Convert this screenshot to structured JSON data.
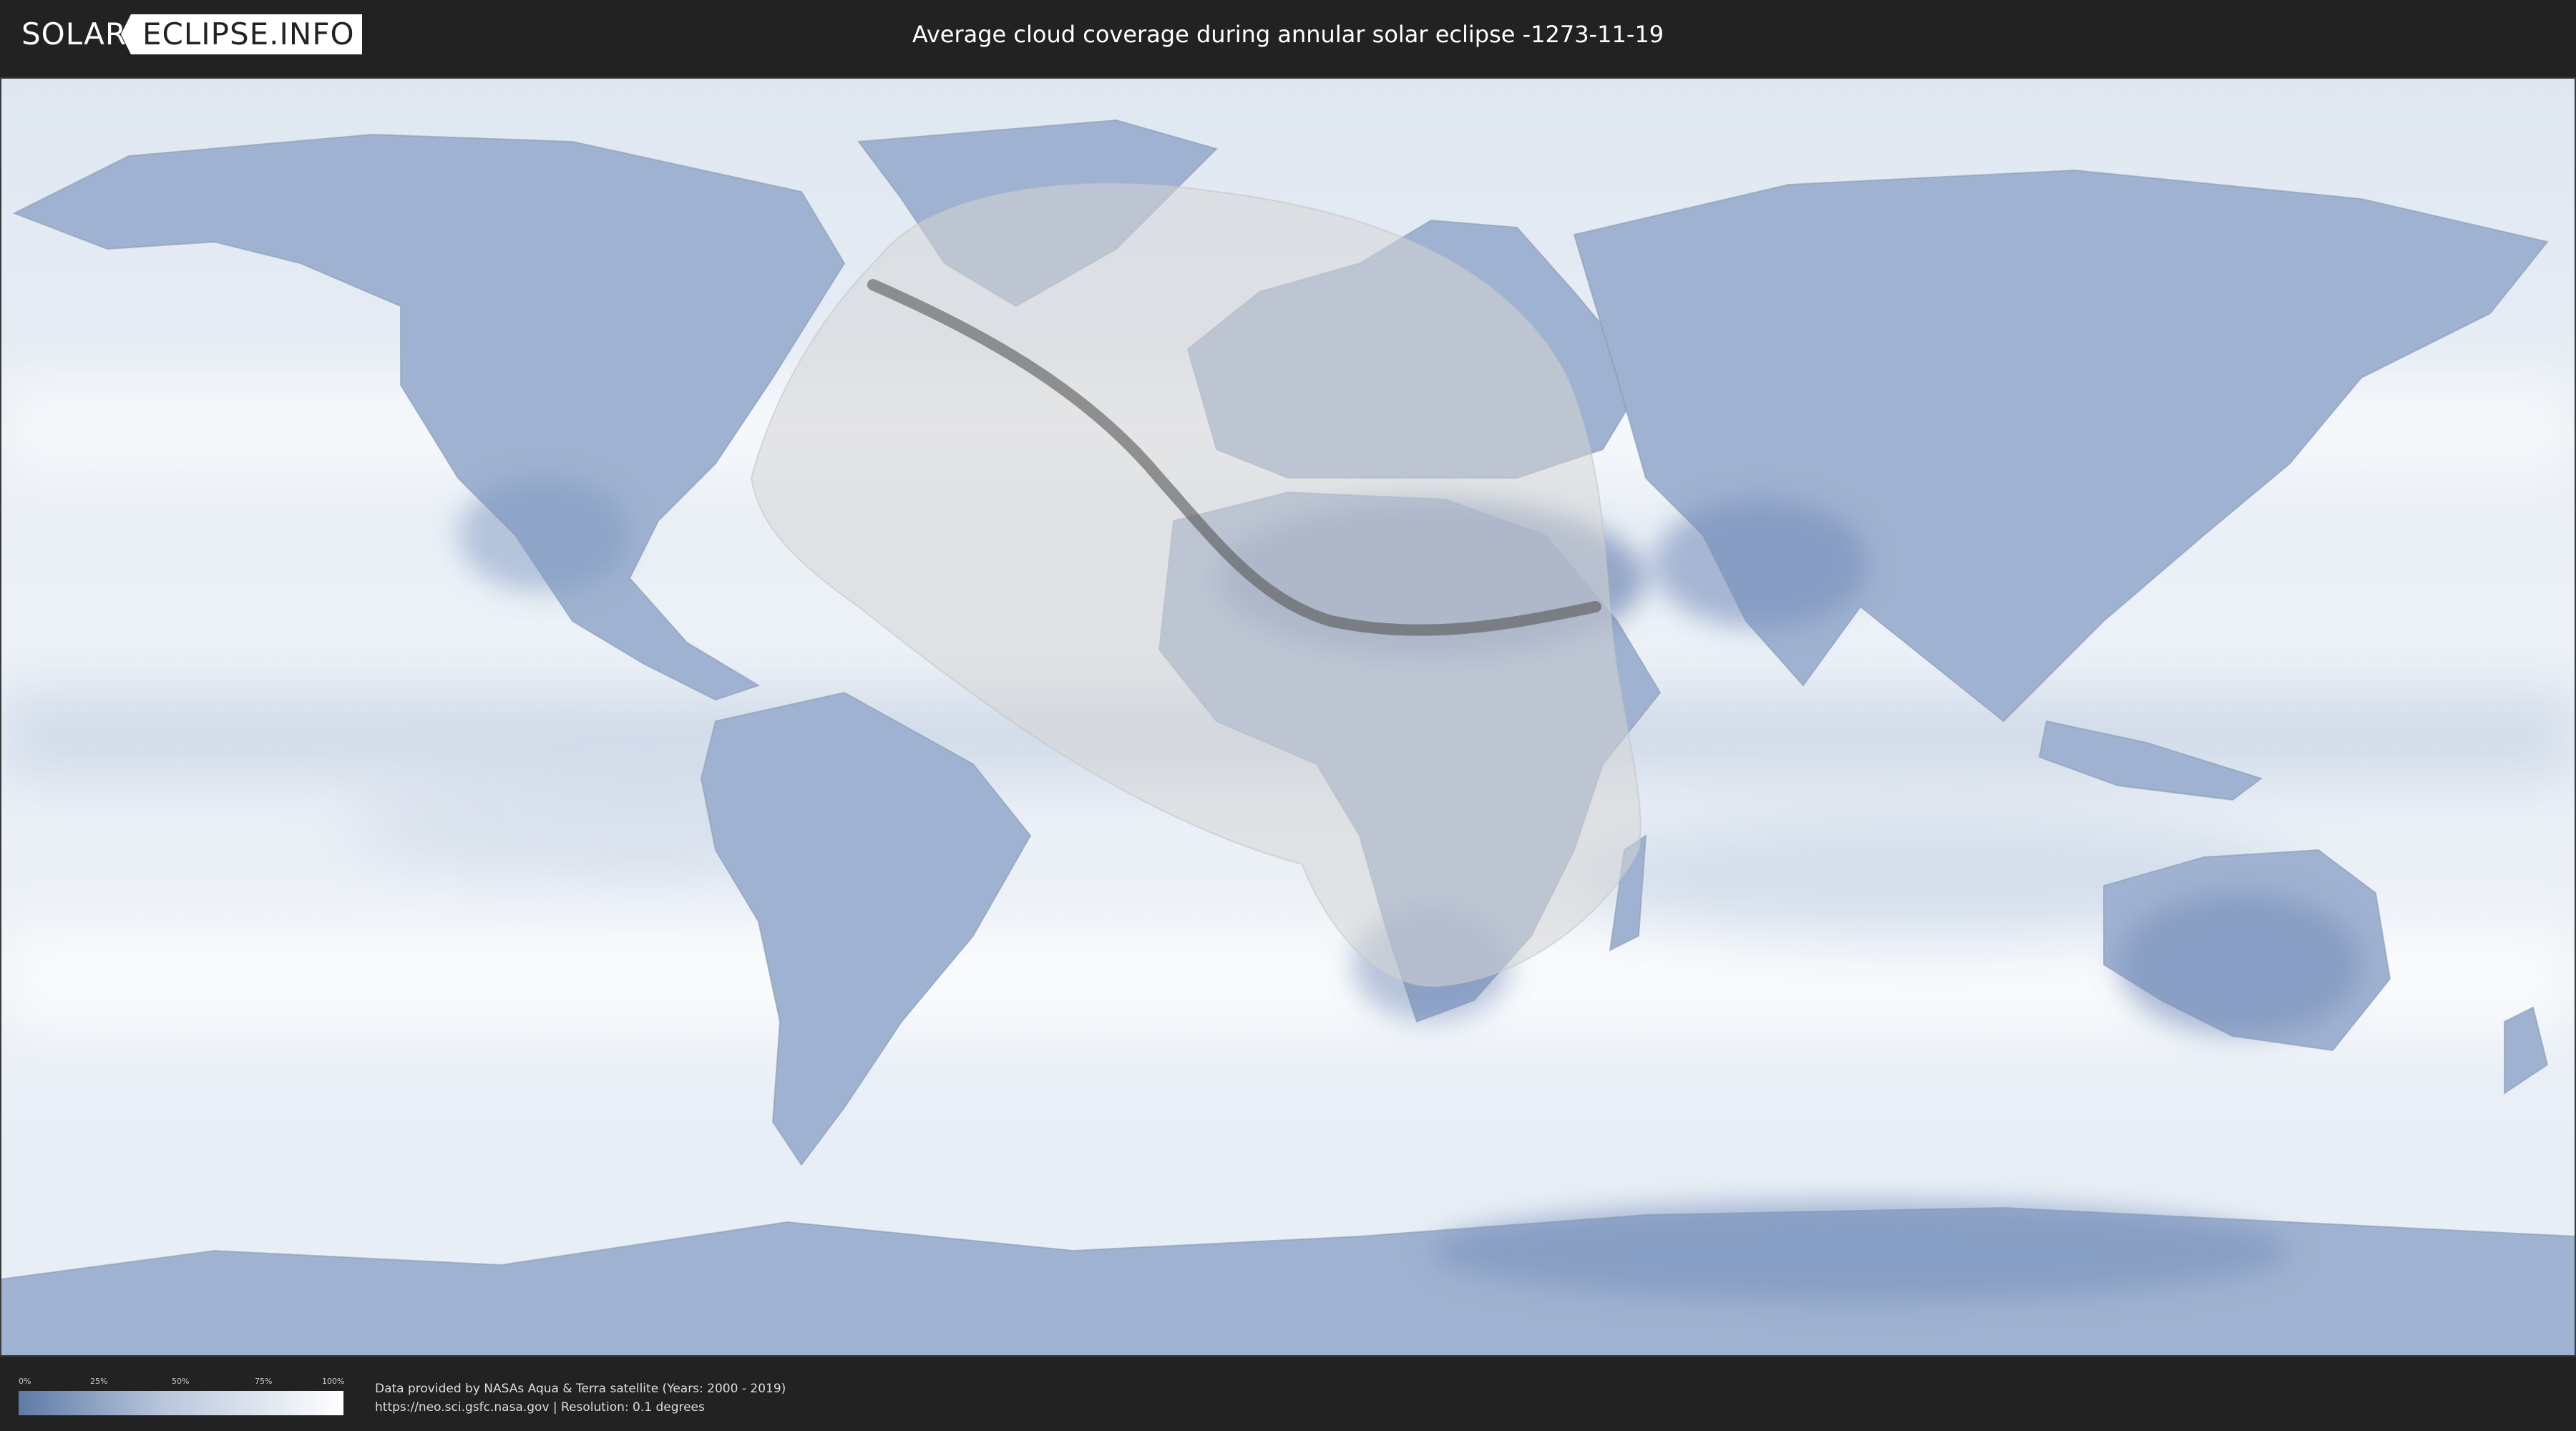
{
  "header": {
    "logo_left": "SOLAR",
    "logo_right": "ECLIPSE.INFO",
    "title": "Average cloud coverage during annular solar eclipse -1273-11-19"
  },
  "legend": {
    "ticks": [
      "0%",
      "25%",
      "50%",
      "75%",
      "100%"
    ],
    "scale_values": [
      0,
      25,
      50,
      75,
      100
    ],
    "colors": {
      "low": "#5f7aa7",
      "mid": "#b9c7dc",
      "high": "#ffffff"
    }
  },
  "credits": {
    "line1": "Data provided by NASAs Aqua & Terra satellite (Years: 2000 - 2019)",
    "line2": "https://neo.sci.gsfc.nasa.gov | Resolution: 0.1 degrees"
  },
  "map": {
    "projection": "equirectangular",
    "colors": {
      "ocean_cloud": "#e8eef6",
      "land_clear": "#7f97bf",
      "eclipse_zone": "#d2d2d2",
      "eclipse_path": "#555555"
    }
  }
}
